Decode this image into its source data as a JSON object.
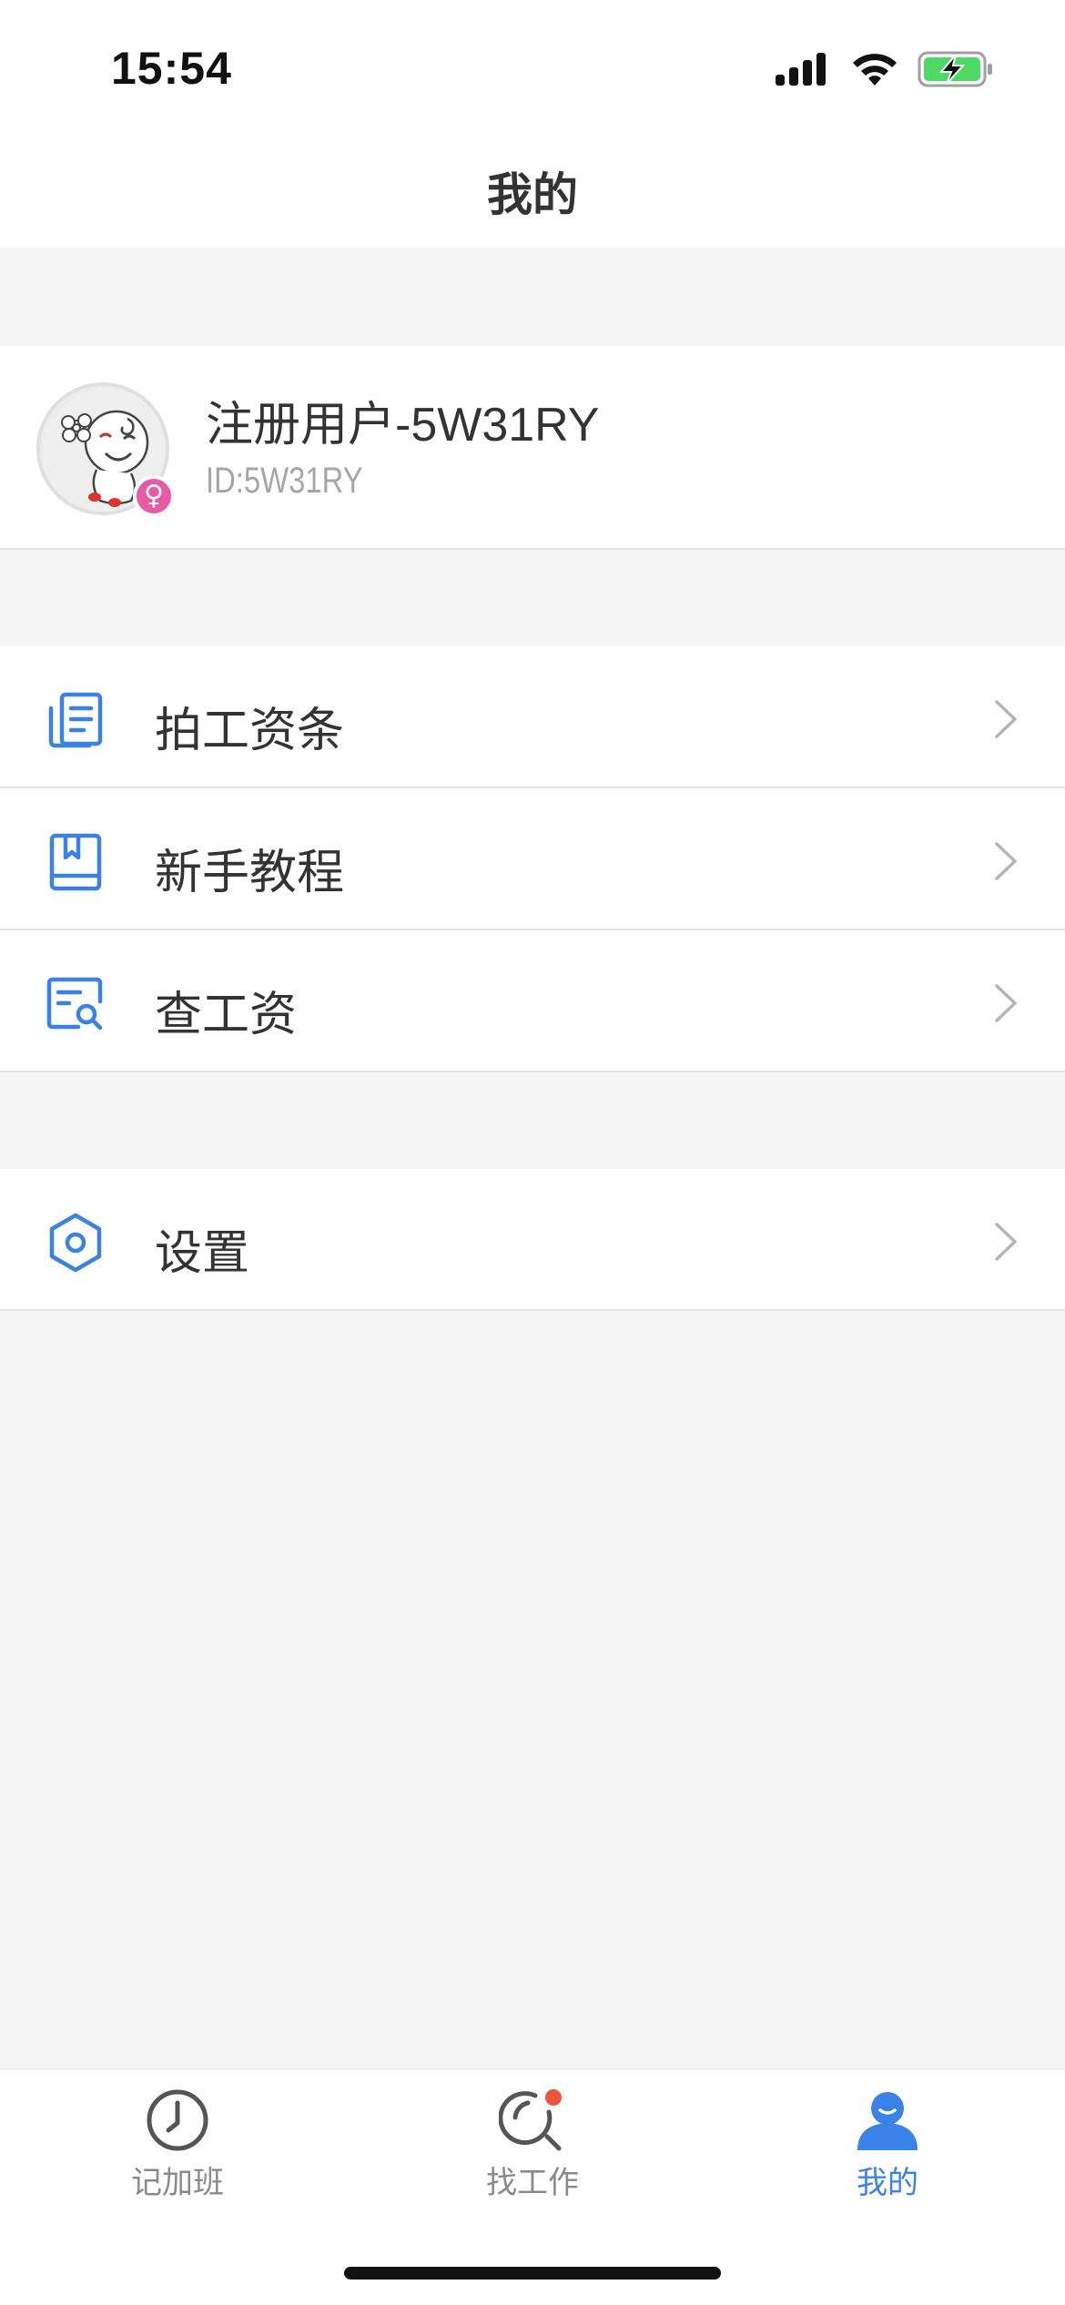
{
  "status_bar": {
    "time": "15:54"
  },
  "nav": {
    "title": "我的"
  },
  "profile": {
    "name": "注册用户-5W31RY",
    "id_text": "ID:5W31RY",
    "gender_symbol": "♀"
  },
  "menu": {
    "group1": [
      {
        "label": "拍工资条",
        "icon": "payslip-icon"
      },
      {
        "label": "新手教程",
        "icon": "book-icon"
      },
      {
        "label": "查工资",
        "icon": "search-document-icon"
      }
    ],
    "group2": [
      {
        "label": "设置",
        "icon": "settings-hexagon-icon"
      }
    ]
  },
  "tabs": [
    {
      "label": "记加班",
      "icon": "clock-icon",
      "active": false
    },
    {
      "label": "找工作",
      "icon": "search-icon",
      "active": false,
      "badge": true
    },
    {
      "label": "我的",
      "icon": "user-icon",
      "active": true
    }
  ],
  "colors": {
    "accent": "#3b82e8",
    "badge_red": "#e8553c",
    "gender_pink": "#e85aa6",
    "background": "#f5f5f5"
  }
}
